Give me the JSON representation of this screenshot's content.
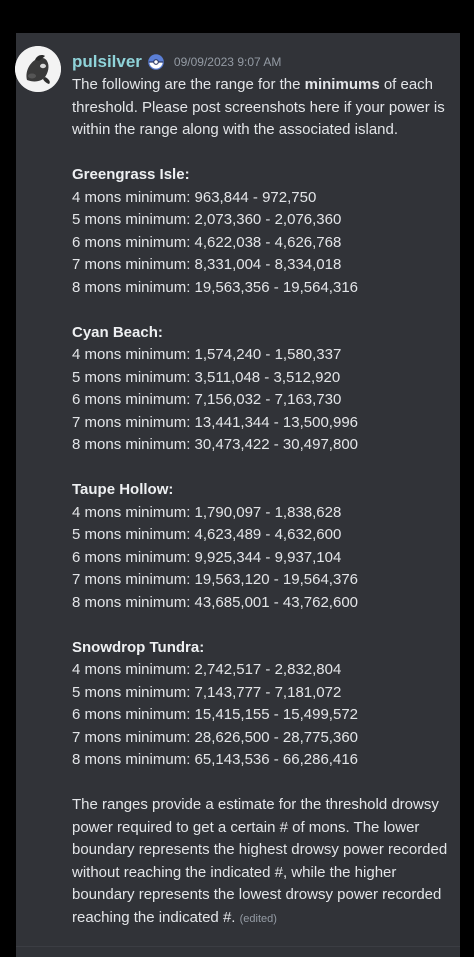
{
  "message": {
    "author": "pulsilver",
    "badge_icon": "pokeball-icon",
    "timestamp": "09/09/2023 9:07 AM",
    "intro_before": "The following are the range for the ",
    "intro_bold": "minimums",
    "intro_after": " of each threshold. Please post screenshots here if your power is within the range along with the associated island.",
    "sections": [
      {
        "title": "Greengrass Isle:",
        "lines": [
          "4 mons minimum: 963,844 - 972,750",
          "5 mons minimum: 2,073,360 - 2,076,360",
          "6 mons minimum: 4,622,038 - 4,626,768",
          "7 mons minimum: 8,331,004 - 8,334,018",
          "8 mons minimum: 19,563,356 - 19,564,316"
        ]
      },
      {
        "title": "Cyan Beach:",
        "lines": [
          "4 mons minimum: 1,574,240 - 1,580,337",
          "5 mons minimum: 3,511,048 - 3,512,920",
          "6 mons minimum: 7,156,032 - 7,163,730",
          "7 mons minimum: 13,441,344 - 13,500,996",
          "8 mons minimum: 30,473,422 - 30,497,800"
        ]
      },
      {
        "title": "Taupe Hollow:",
        "lines": [
          "4 mons minimum: 1,790,097 - 1,838,628",
          "5 mons minimum: 4,623,489 - 4,632,600",
          "6 mons minimum: 9,925,344 - 9,937,104",
          "7 mons minimum: 19,563,120 - 19,564,376",
          "8 mons minimum: 43,685,001 - 43,762,600"
        ]
      },
      {
        "title": "Snowdrop Tundra:",
        "lines": [
          "4 mons minimum: 2,742,517 - 2,832,804",
          "5 mons minimum: 7,143,777 - 7,181,072",
          "6 mons minimum: 15,415,155 - 15,499,572",
          "7 mons minimum: 28,626,500 - 28,775,360",
          "8 mons minimum: 65,143,536 - 66,286,416"
        ]
      }
    ],
    "outro": "The ranges provide a estimate for the threshold drowsy power required to get a certain # of mons. The lower boundary represents the highest drowsy power recorded without reaching the indicated #, while the higher boundary represents the lowest drowsy power recorded reaching the indicated #.",
    "edited_label": "(edited)"
  }
}
